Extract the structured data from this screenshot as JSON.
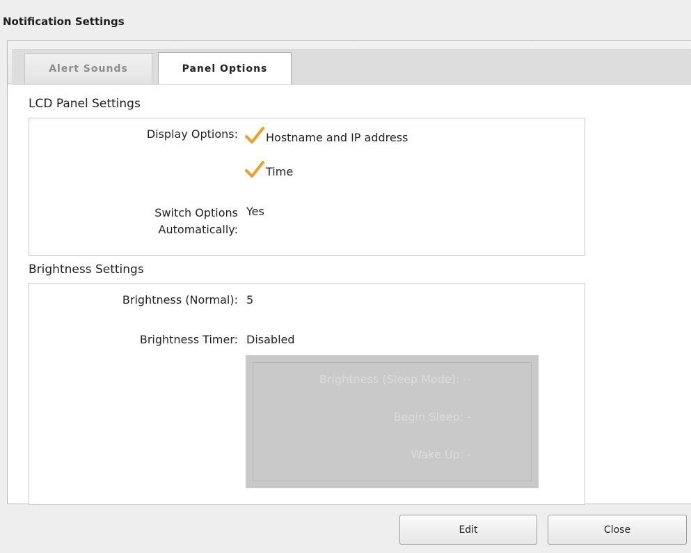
{
  "window": {
    "title": "Notification Settings"
  },
  "tabs": [
    {
      "label": "Alert Sounds",
      "active": false
    },
    {
      "label": "Panel Options",
      "active": true
    }
  ],
  "lcd": {
    "section_title": "LCD Panel Settings",
    "display_options_label": "Display Options:",
    "display_options": [
      "Hostname and IP address",
      "Time"
    ],
    "switch_label_line1": "Switch Options",
    "switch_label_line2": "Automatically:",
    "switch_value": "Yes"
  },
  "brightness": {
    "section_title": "Brightness Settings",
    "normal_label": "Brightness (Normal):",
    "normal_value": "5",
    "timer_label": "Brightness Timer:",
    "timer_value": "Disabled",
    "sleep_mode": "Brightness (Sleep Mode): --",
    "begin_sleep": "Begin Sleep: -",
    "wake_up": "Wake Up: -"
  },
  "buttons": {
    "edit": "Edit",
    "close": "Close"
  },
  "colors": {
    "check": "#f39c1d",
    "disabled_panel": "#c9c9c9"
  }
}
